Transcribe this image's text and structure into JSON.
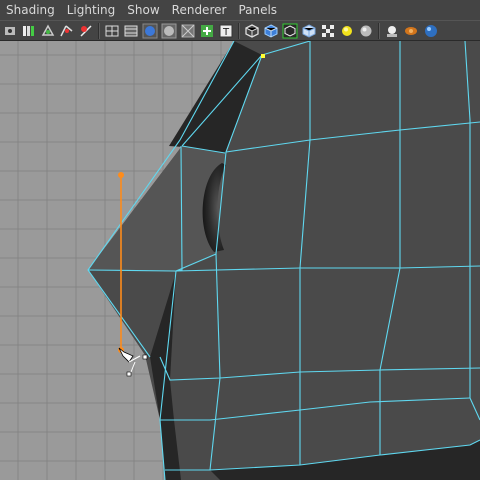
{
  "menubar": {
    "items": [
      "Shading",
      "Lighting",
      "Show",
      "Renderer",
      "Panels"
    ]
  },
  "toolbar": {
    "icons": [
      "select-camera-icon",
      "camera-attributes-icon",
      "bookmark-icon",
      "image-plane-icon",
      "grid-toggle-icon",
      "wireframe-icon",
      "smooth-shade-icon",
      "flat-shade-icon",
      "bounding-box-icon",
      "use-default-material-icon",
      "textured-icon",
      "wireframe-on-shaded-icon",
      "xray-icon",
      "xray-joints-icon",
      "backface-culling-icon",
      "shadows-icon",
      "use-all-lights-icon",
      "default-light-icon",
      "two-sided-lighting-icon",
      "high-quality-icon",
      "ambient-occlusion-icon",
      "cube-icon"
    ]
  },
  "viewport": {
    "background": "#9a9a9a",
    "grid_color": "#858585",
    "mesh_fill": "#4a4a4a",
    "mesh_dark": "#262626",
    "wire_color": "#5fd8f0",
    "active_edge_color": "#ff8c1a",
    "selected_vertex_color": "#ffff33"
  }
}
